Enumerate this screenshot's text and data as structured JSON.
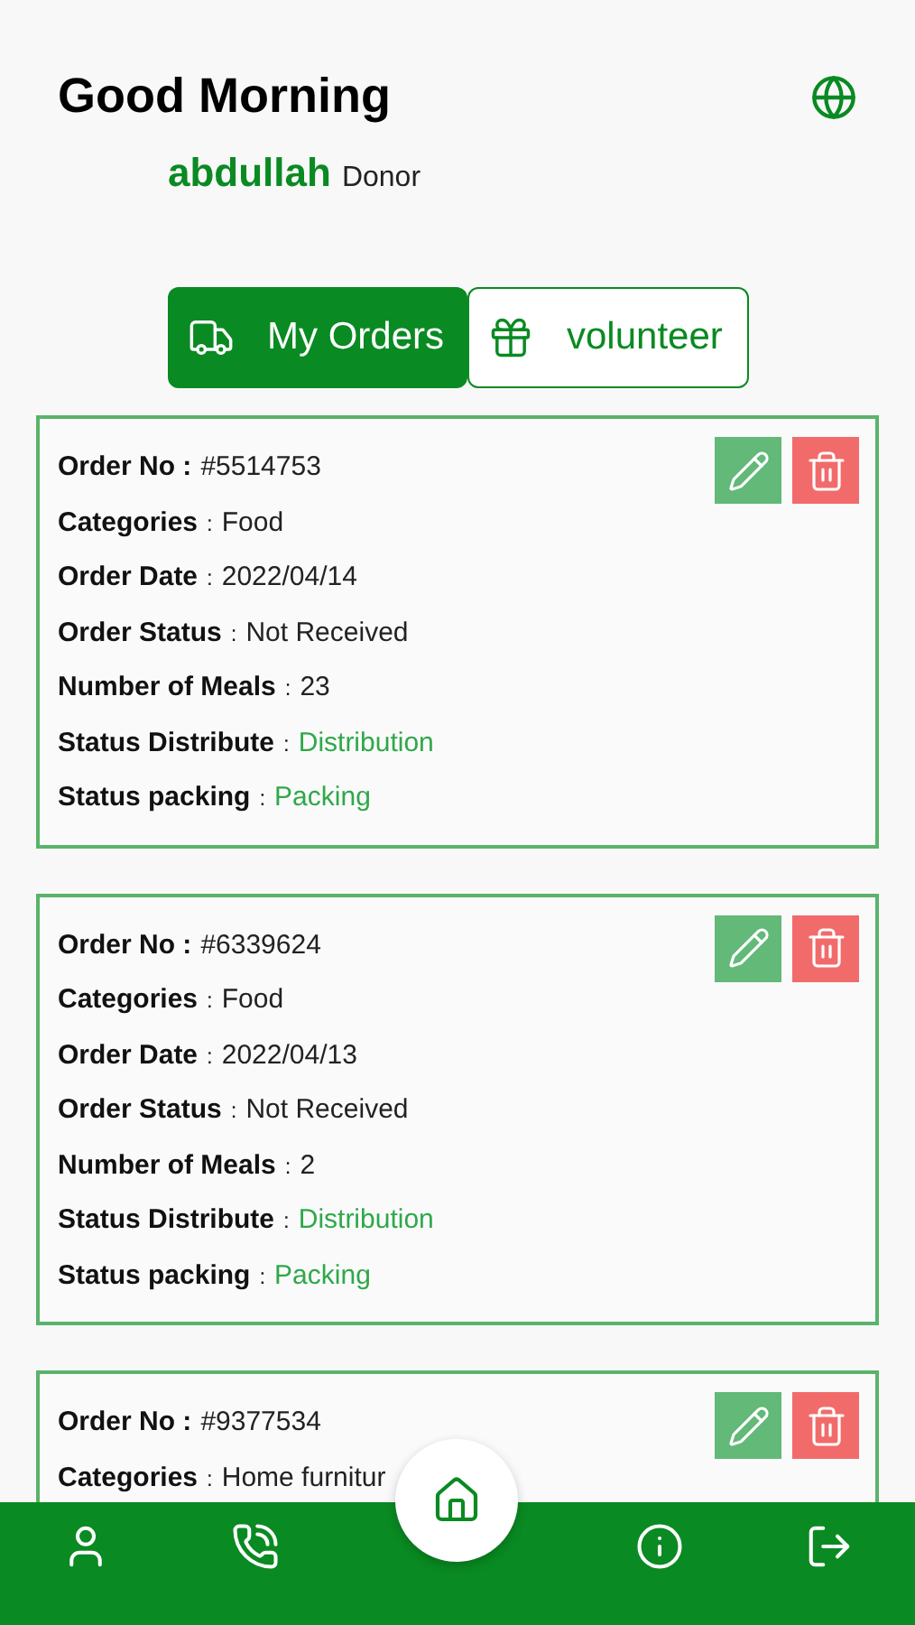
{
  "header": {
    "greeting": "Good Morning",
    "user_name": "abdullah",
    "role": "Donor"
  },
  "tabs": [
    {
      "label": "My Orders",
      "selected": true
    },
    {
      "label": "volunteer",
      "selected": false
    }
  ],
  "orders": [
    {
      "fields": [
        {
          "label": "Order No :",
          "value": "#5514753",
          "kind": "plain"
        },
        {
          "label": "Categories",
          "sep": ":",
          "value": "Food",
          "kind": "plain"
        },
        {
          "label": "Order Date",
          "sep": ":",
          "value": "2022/04/14",
          "kind": "plain"
        },
        {
          "label": "Order Status",
          "sep": ":",
          "value": "Not Received",
          "kind": "plain"
        },
        {
          "label": "Number of Meals",
          "sep": ":",
          "value": "23",
          "kind": "plain"
        },
        {
          "label": "Status Distribute",
          "sep": ":",
          "value": "Distribution",
          "kind": "status"
        },
        {
          "label": "Status packing",
          "sep": ":",
          "value": "Packing",
          "kind": "status"
        }
      ]
    },
    {
      "fields": [
        {
          "label": "Order No :",
          "value": "#6339624",
          "kind": "plain"
        },
        {
          "label": "Categories",
          "sep": ":",
          "value": "Food",
          "kind": "plain"
        },
        {
          "label": "Order Date",
          "sep": ":",
          "value": "2022/04/13",
          "kind": "plain"
        },
        {
          "label": "Order Status",
          "sep": ":",
          "value": "Not Received",
          "kind": "plain"
        },
        {
          "label": "Number of Meals",
          "sep": ":",
          "value": "2",
          "kind": "plain"
        },
        {
          "label": "Status Distribute",
          "sep": ":",
          "value": "Distribution",
          "kind": "status"
        },
        {
          "label": "Status packing",
          "sep": ":",
          "value": "Packing",
          "kind": "status"
        }
      ]
    },
    {
      "fields": [
        {
          "label": "Order No :",
          "value": "#9377534",
          "kind": "plain"
        },
        {
          "label": "Categories",
          "sep": ":",
          "value": "Home furnitur",
          "kind": "plain"
        }
      ]
    }
  ],
  "bottom_nav": [
    {
      "selected": false
    },
    {
      "selected": false
    },
    {
      "selected": true
    },
    {
      "selected": false
    },
    {
      "selected": false
    }
  ]
}
